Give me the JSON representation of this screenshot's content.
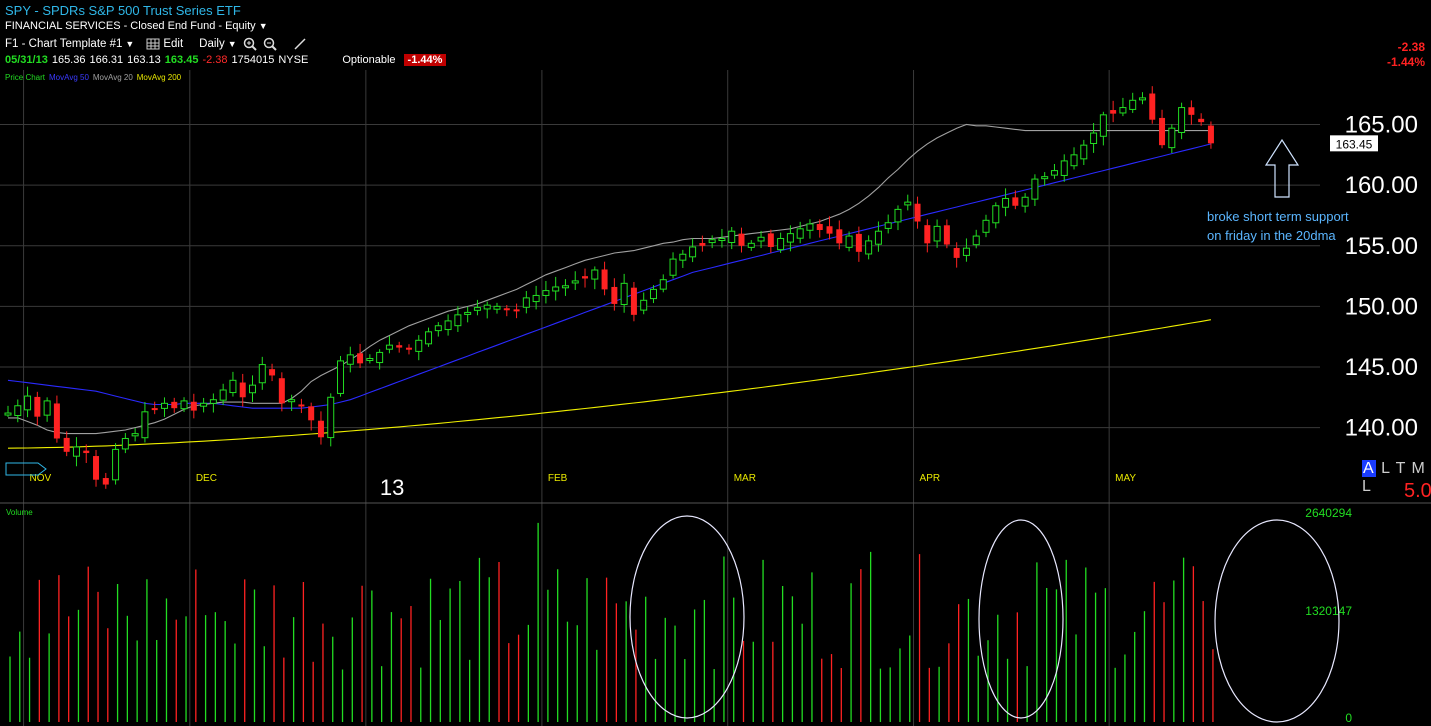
{
  "header": {
    "title": "SPY - SPDRs S&P 500 Trust Series ETF",
    "subtitle": "FINANCIAL SERVICES - Closed End Fund - Equity",
    "template": "F1 - Chart Template #1",
    "edit_label": "Edit",
    "period": "Daily",
    "icons": [
      "zoom-in-icon",
      "zoom-out-icon",
      "draw-line-icon"
    ]
  },
  "quote": {
    "date": "05/31/13",
    "open": "165.36",
    "high": "166.31",
    "low": "163.13",
    "last": "163.45",
    "change": "-2.38",
    "volume": "1754015",
    "exchange": "NYSE",
    "optionable": "Optionable",
    "pct_change": "-1.44%"
  },
  "right_change": {
    "change": "-2.38",
    "pct": "-1.44%"
  },
  "studies": {
    "price": "Price Chart",
    "ma50": "MovAvg 50",
    "ma20": "MovAvg 20",
    "ma200": "MovAvg 200"
  },
  "colors": {
    "up": "#22dd22",
    "down": "#ff2222",
    "ma50": "#2a2aff",
    "ma20": "#a0a0a0",
    "ma200": "#f0f000",
    "grid": "#3a3a3a",
    "annotation": "#5bb6ff"
  },
  "annotation": {
    "line1": "broke short term support",
    "line2": "on friday in the 20dma"
  },
  "alt_toolbar": {
    "label_a": "A",
    "label_rest": "L T M L",
    "value": "5.0"
  },
  "volume_labels": {
    "title": "Volume",
    "max": "2640294",
    "mid": "1320147",
    "zero": "0"
  },
  "chart_data": {
    "type": "candlestick",
    "y_ticks": [
      "165.00",
      "160.00",
      "155.00",
      "150.00",
      "145.00",
      "140.00"
    ],
    "ylim": [
      136.5,
      169.5
    ],
    "last_price_label": "163.45",
    "month_labels": [
      {
        "label": "NOV",
        "bar": 2
      },
      {
        "label": "DEC",
        "bar": 19
      },
      {
        "label": "13",
        "bar": 37
      },
      {
        "label": "FEB",
        "bar": 55
      },
      {
        "label": "MAR",
        "bar": 74
      },
      {
        "label": "APR",
        "bar": 93
      },
      {
        "label": "MAY",
        "bar": 113
      }
    ],
    "closes": [
      141.2,
      141.8,
      142.6,
      140.9,
      142.2,
      139.1,
      138.0,
      138.4,
      137.9,
      135.7,
      135.3,
      138.2,
      139.1,
      139.5,
      141.3,
      141.5,
      142.0,
      141.6,
      142.2,
      141.4,
      142.0,
      142.3,
      143.1,
      143.9,
      142.5,
      143.5,
      145.2,
      144.3,
      142.0,
      142.3,
      141.8,
      140.6,
      139.2,
      142.5,
      145.5,
      146.0,
      145.3,
      145.7,
      146.2,
      146.8,
      146.6,
      146.5,
      147.2,
      147.9,
      148.4,
      148.8,
      149.3,
      149.5,
      149.9,
      150.1,
      150.0,
      149.8,
      149.6,
      150.7,
      150.9,
      151.3,
      151.6,
      151.7,
      152.1,
      152.3,
      153.0,
      151.4,
      150.2,
      151.9,
      149.3,
      150.5,
      151.4,
      152.2,
      153.9,
      154.3,
      154.9,
      155.0,
      155.5,
      155.6,
      156.2,
      155.0,
      155.2,
      155.7,
      154.9,
      155.6,
      156.0,
      156.4,
      156.8,
      156.3,
      156.0,
      155.2,
      155.8,
      154.5,
      155.4,
      156.2,
      156.9,
      158.0,
      158.6,
      157.0,
      155.2,
      156.6,
      155.1,
      154.0,
      154.8,
      155.8,
      157.1,
      158.3,
      158.9,
      158.3,
      159.0,
      160.5,
      160.7,
      161.2,
      162.0,
      162.5,
      163.3,
      164.3,
      165.8,
      165.9,
      166.4,
      167.0,
      167.2,
      165.4,
      163.3,
      164.7,
      166.4,
      165.8,
      165.2,
      163.45
    ],
    "ma20": [
      140.8,
      140.8,
      140.5,
      140.2,
      139.8,
      139.6,
      139.5,
      139.5,
      139.5,
      139.5,
      139.6,
      139.7,
      139.8,
      140.0,
      140.2,
      140.4,
      140.7,
      141.1,
      141.5,
      141.8,
      141.9,
      142.0,
      142.1,
      142.1,
      142.1,
      142.0,
      142.0,
      142.0,
      142.0,
      142.4,
      143.0,
      143.8,
      144.3,
      144.7,
      145.1,
      145.6,
      146.1,
      146.7,
      147.2,
      147.6,
      148.0,
      148.4,
      148.7,
      149.0,
      149.3,
      149.6,
      149.8,
      150.0,
      150.2,
      150.5,
      150.8,
      151.1,
      151.4,
      151.8,
      152.2,
      152.6,
      152.9,
      153.2,
      153.5,
      153.8,
      154.0,
      154.2,
      154.4,
      154.5,
      154.6,
      154.8,
      155.0,
      155.2,
      155.3,
      155.5,
      155.6,
      155.6,
      155.6,
      155.7,
      155.8,
      155.9,
      156.0,
      156.1,
      156.2,
      156.3,
      156.4,
      156.6,
      156.8,
      157.0,
      157.3,
      157.6,
      158.0,
      158.5,
      159.1,
      159.8,
      160.6,
      161.3,
      162.1,
      162.8,
      163.4,
      163.9,
      164.3,
      164.7,
      165.0,
      164.9,
      164.9,
      164.8,
      164.7,
      164.6,
      164.5,
      164.5,
      164.5,
      164.5,
      164.5,
      164.5,
      164.5,
      164.5,
      164.5,
      164.5,
      164.5,
      164.5,
      164.5,
      164.5,
      164.5,
      164.5,
      164.5,
      164.5,
      164.5,
      164.5
    ],
    "ma50": [
      143.9,
      143.8,
      143.7,
      143.6,
      143.5,
      143.4,
      143.3,
      143.2,
      143.1,
      143.0,
      142.8,
      142.6,
      142.4,
      142.2,
      142.0,
      141.9,
      141.9,
      141.9,
      142.0,
      142.0,
      142.0,
      142.0,
      141.9,
      141.8,
      141.7,
      141.6,
      141.6,
      141.6,
      141.6,
      141.6,
      141.6,
      141.7,
      141.8,
      141.9,
      142.1,
      142.3,
      142.6,
      142.9,
      143.2,
      143.5,
      143.8,
      144.1,
      144.4,
      144.7,
      145.0,
      145.3,
      145.6,
      145.9,
      146.2,
      146.5,
      146.8,
      147.1,
      147.4,
      147.7,
      148.0,
      148.3,
      148.6,
      148.9,
      149.2,
      149.5,
      149.8,
      150.1,
      150.4,
      150.7,
      151.0,
      151.3,
      151.6,
      151.9,
      152.2,
      152.5,
      152.8,
      153.0,
      153.2,
      153.4,
      153.6,
      153.8,
      154.0,
      154.2,
      154.4,
      154.6,
      154.8,
      155.0,
      155.2,
      155.4,
      155.6,
      155.8,
      156.0,
      156.2,
      156.4,
      156.6,
      156.8,
      157.0,
      157.2,
      157.4,
      157.6,
      157.8,
      158.0,
      158.2,
      158.4,
      158.6,
      158.8,
      159.0,
      159.2,
      159.4,
      159.6,
      159.8,
      160.0,
      160.2,
      160.4,
      160.6,
      160.8,
      161.0,
      161.2,
      161.4,
      161.6,
      161.8,
      162.0,
      162.2,
      162.4,
      162.6,
      162.8,
      163.0,
      163.2,
      163.4
    ],
    "ma200_range": [
      138.3,
      148.9
    ],
    "volume_max": 2640294
  }
}
